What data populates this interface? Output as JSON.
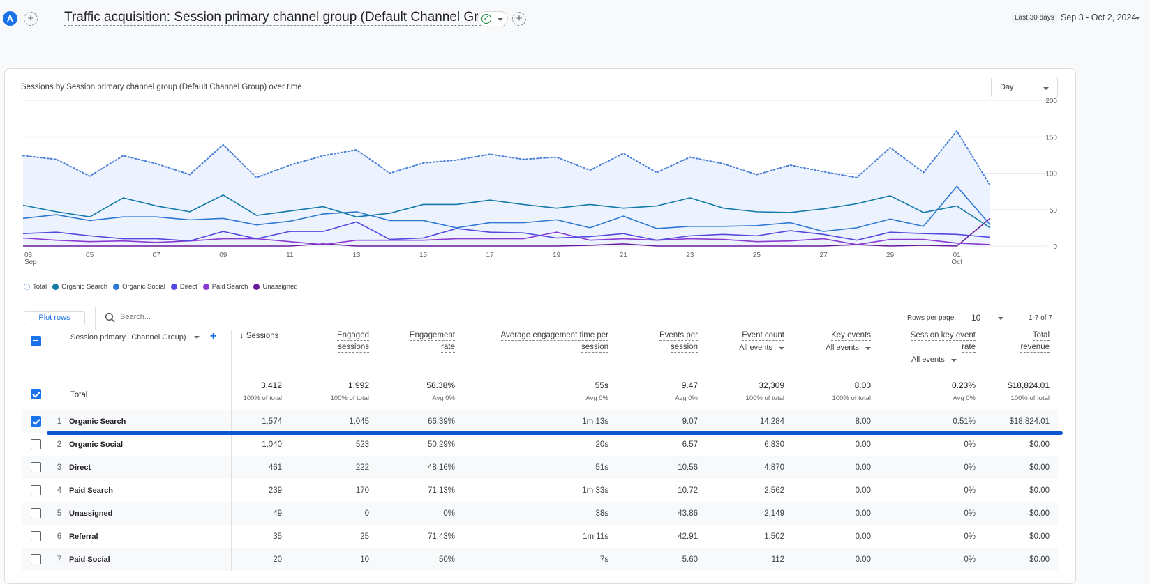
{
  "header": {
    "avatar_letter": "A",
    "title": "Traffic acquisition: Session primary channel group (Default Channel Group)",
    "status_icon": "check-circle-icon",
    "date_chip": "Last 30 days",
    "date_range": "Sep 3 - Oct 2, 2024"
  },
  "chart_card": {
    "title": "Sessions by Session primary channel group (Default Channel Group) over time",
    "granularity": "Day"
  },
  "chart_data": {
    "type": "line",
    "title": "Sessions by Session primary channel group (Default Channel Group) over time",
    "xlabel": "",
    "ylabel": "",
    "ylim": [
      0,
      200
    ],
    "yticks": [
      0,
      50,
      100,
      150,
      200
    ],
    "grid": true,
    "legend_position": "bottom-left",
    "x": [
      "Sep 3",
      "Sep 4",
      "Sep 5",
      "Sep 6",
      "Sep 7",
      "Sep 8",
      "Sep 9",
      "Sep 10",
      "Sep 11",
      "Sep 12",
      "Sep 13",
      "Sep 14",
      "Sep 15",
      "Sep 16",
      "Sep 17",
      "Sep 18",
      "Sep 19",
      "Sep 20",
      "Sep 21",
      "Sep 22",
      "Sep 23",
      "Sep 24",
      "Sep 25",
      "Sep 26",
      "Sep 27",
      "Sep 28",
      "Sep 29",
      "Sep 30",
      "Oct 1",
      "Oct 2"
    ],
    "xtick_labels": [
      {
        "index": 0,
        "label": "03",
        "sub": "Sep"
      },
      {
        "index": 2,
        "label": "05",
        "sub": ""
      },
      {
        "index": 4,
        "label": "07",
        "sub": ""
      },
      {
        "index": 6,
        "label": "09",
        "sub": ""
      },
      {
        "index": 8,
        "label": "11",
        "sub": ""
      },
      {
        "index": 10,
        "label": "13",
        "sub": ""
      },
      {
        "index": 12,
        "label": "15",
        "sub": ""
      },
      {
        "index": 14,
        "label": "17",
        "sub": ""
      },
      {
        "index": 16,
        "label": "19",
        "sub": ""
      },
      {
        "index": 18,
        "label": "21",
        "sub": ""
      },
      {
        "index": 20,
        "label": "23",
        "sub": ""
      },
      {
        "index": 22,
        "label": "25",
        "sub": ""
      },
      {
        "index": 24,
        "label": "27",
        "sub": ""
      },
      {
        "index": 26,
        "label": "29",
        "sub": ""
      },
      {
        "index": 28,
        "label": "01",
        "sub": "Oct"
      }
    ],
    "series": [
      {
        "name": "Total",
        "color": "#4a7fd4",
        "style": "dotted",
        "fill": true,
        "values": [
          124,
          119,
          96,
          124,
          113,
          98,
          139,
          94,
          111,
          124,
          132,
          100,
          114,
          118,
          126,
          119,
          122,
          104,
          127,
          101,
          122,
          113,
          98,
          111,
          102,
          94,
          135,
          101,
          158,
          83
        ]
      },
      {
        "name": "Organic Search",
        "color": "#1379a8",
        "style": "solid",
        "values": [
          56,
          47,
          40,
          66,
          55,
          47,
          70,
          42,
          48,
          54,
          40,
          45,
          57,
          57,
          63,
          57,
          52,
          57,
          52,
          55,
          66,
          52,
          47,
          46,
          51,
          58,
          69,
          46,
          55,
          25
        ]
      },
      {
        "name": "Organic Social",
        "color": "#2e78d2",
        "style": "solid",
        "values": [
          38,
          43,
          35,
          40,
          40,
          36,
          38,
          29,
          34,
          44,
          47,
          35,
          35,
          25,
          32,
          32,
          36,
          25,
          41,
          24,
          27,
          27,
          28,
          32,
          20,
          25,
          37,
          27,
          82,
          29
        ]
      },
      {
        "name": "Direct",
        "color": "#5349e0",
        "style": "solid",
        "values": [
          17,
          19,
          14,
          10,
          10,
          7,
          20,
          10,
          20,
          20,
          33,
          9,
          11,
          24,
          19,
          18,
          11,
          13,
          17,
          8,
          14,
          16,
          14,
          21,
          16,
          8,
          19,
          17,
          16,
          12
        ]
      },
      {
        "name": "Paid Search",
        "color": "#8a3ad1",
        "style": "solid",
        "values": [
          11,
          8,
          6,
          7,
          5,
          7,
          10,
          10,
          6,
          2,
          8,
          8,
          8,
          10,
          10,
          10,
          19,
          8,
          10,
          8,
          10,
          9,
          6,
          7,
          10,
          2,
          9,
          9,
          4,
          2
        ]
      },
      {
        "name": "Unassigned",
        "color": "#6a1b9a",
        "style": "solid",
        "values": [
          0,
          0,
          0,
          0,
          0,
          0,
          0,
          0,
          0,
          3,
          0,
          0,
          0,
          0,
          0,
          0,
          0,
          1,
          3,
          0,
          0,
          0,
          0,
          0,
          0,
          2,
          0,
          1,
          0,
          38
        ]
      }
    ]
  },
  "legend": [
    {
      "label": "Total",
      "color": "#4a7fd4",
      "dashed": true
    },
    {
      "label": "Organic Search",
      "color": "#1379a8"
    },
    {
      "label": "Organic Social",
      "color": "#2e78d2"
    },
    {
      "label": "Direct",
      "color": "#5349e0"
    },
    {
      "label": "Paid Search",
      "color": "#8a3ad1"
    },
    {
      "label": "Unassigned",
      "color": "#6a1b9a"
    }
  ],
  "toolbar": {
    "plot_rows_label": "Plot rows",
    "search_placeholder": "Search...",
    "rows_per_page_label": "Rows per page:",
    "rows_per_page_value": "10",
    "page_range": "1-7 of 7"
  },
  "table": {
    "dimension_header": "Session primary...Channel Group)",
    "columns": [
      {
        "line1": "Sessions",
        "line2": "",
        "sub": "",
        "sorted": true
      },
      {
        "line1": "Engaged",
        "line2": "sessions",
        "sub": ""
      },
      {
        "line1": "Engagement",
        "line2": "rate",
        "sub": ""
      },
      {
        "line1": "Average engagement time per",
        "line2": "session",
        "sub": ""
      },
      {
        "line1": "Events per",
        "line2": "session",
        "sub": ""
      },
      {
        "line1": "Event count",
        "line2": "",
        "sub": "All events"
      },
      {
        "line1": "Key events",
        "line2": "",
        "sub": "All events"
      },
      {
        "line1": "Session key event",
        "line2": "rate",
        "sub": "All events"
      },
      {
        "line1": "Total",
        "line2": "revenue",
        "sub": ""
      }
    ],
    "total": {
      "label": "Total",
      "values": [
        "3,412",
        "1,992",
        "58.38%",
        "55s",
        "9.47",
        "32,309",
        "8.00",
        "0.23%",
        "$18,824.01"
      ],
      "subs": [
        "100% of total",
        "100% of total",
        "Avg 0%",
        "Avg 0%",
        "Avg 0%",
        "100% of total",
        "100% of total",
        "Avg 0%",
        "100% of total"
      ]
    },
    "rows": [
      {
        "rank": "1",
        "name": "Organic Search",
        "checked": true,
        "values": [
          "1,574",
          "1,045",
          "66.39%",
          "1m 13s",
          "9.07",
          "14,284",
          "8.00",
          "0.51%",
          "$18,824.01"
        ]
      },
      {
        "rank": "2",
        "name": "Organic Social",
        "checked": false,
        "values": [
          "1,040",
          "523",
          "50.29%",
          "20s",
          "6.57",
          "6,830",
          "0.00",
          "0%",
          "$0.00"
        ]
      },
      {
        "rank": "3",
        "name": "Direct",
        "checked": false,
        "values": [
          "461",
          "222",
          "48.16%",
          "51s",
          "10.56",
          "4,870",
          "0.00",
          "0%",
          "$0.00"
        ]
      },
      {
        "rank": "4",
        "name": "Paid Search",
        "checked": false,
        "values": [
          "239",
          "170",
          "71.13%",
          "1m 33s",
          "10.72",
          "2,562",
          "0.00",
          "0%",
          "$0.00"
        ]
      },
      {
        "rank": "5",
        "name": "Unassigned",
        "checked": false,
        "values": [
          "49",
          "0",
          "0%",
          "38s",
          "43.86",
          "2,149",
          "0.00",
          "0%",
          "$0.00"
        ]
      },
      {
        "rank": "6",
        "name": "Referral",
        "checked": false,
        "values": [
          "35",
          "25",
          "71.43%",
          "1m 11s",
          "42.91",
          "1,502",
          "0.00",
          "0%",
          "$0.00"
        ]
      },
      {
        "rank": "7",
        "name": "Paid Social",
        "checked": false,
        "values": [
          "20",
          "10",
          "50%",
          "7s",
          "5.60",
          "112",
          "0.00",
          "0%",
          "$0.00"
        ]
      }
    ]
  }
}
